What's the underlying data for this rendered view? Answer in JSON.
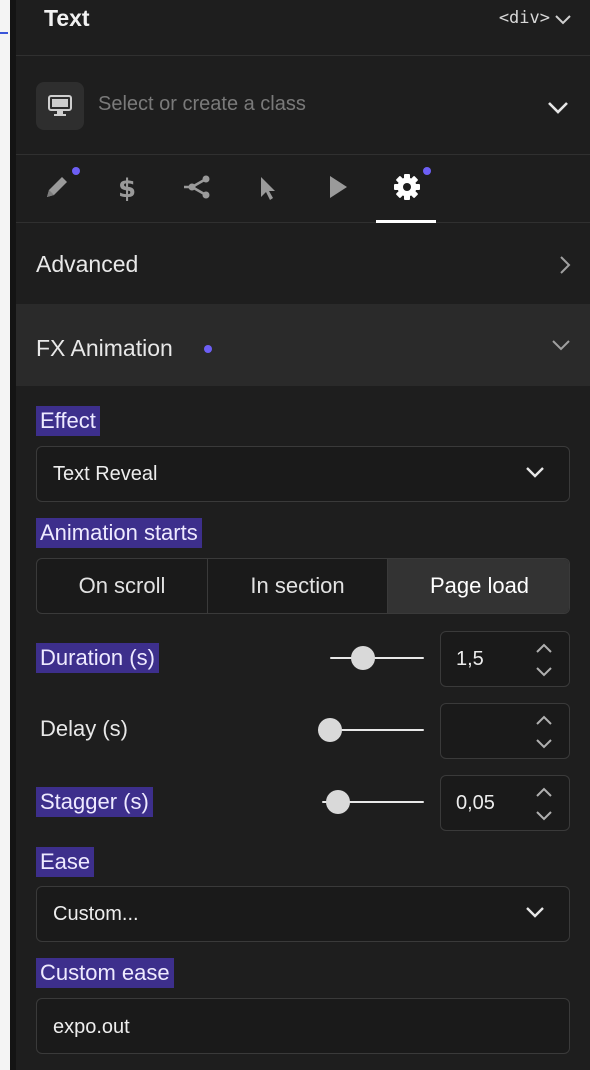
{
  "header": {
    "title": "Text",
    "tag": "<div>"
  },
  "class_selector": {
    "placeholder": "Select or create a class"
  },
  "tabs": [
    {
      "name": "style",
      "icon": "pencil-icon",
      "has_dot": true
    },
    {
      "name": "dollar",
      "icon": "dollar-icon",
      "has_dot": false
    },
    {
      "name": "share",
      "icon": "share-icon",
      "has_dot": false
    },
    {
      "name": "pointer",
      "icon": "cursor-icon",
      "has_dot": false
    },
    {
      "name": "play",
      "icon": "play-icon",
      "has_dot": false
    },
    {
      "name": "settings",
      "icon": "gear-icon",
      "has_dot": true,
      "active": true
    }
  ],
  "advanced": {
    "label": "Advanced"
  },
  "fx": {
    "label": "FX Animation"
  },
  "effect": {
    "label": "Effect",
    "value": "Text Reveal"
  },
  "animation_starts": {
    "label": "Animation starts",
    "options": [
      "On scroll",
      "In section",
      "Page load"
    ],
    "selected": "Page load"
  },
  "duration": {
    "label": "Duration (s)",
    "value": "1,5",
    "slider_fraction": 0.3
  },
  "delay": {
    "label": "Delay (s)",
    "value": "",
    "slider_fraction": 0
  },
  "stagger": {
    "label": "Stagger (s)",
    "value": "0,05",
    "slider_fraction": 0.05
  },
  "ease": {
    "label": "Ease",
    "value": "Custom..."
  },
  "custom_ease": {
    "label": "Custom ease",
    "value": "expo.out"
  },
  "colors": {
    "accent": "#6d5ff5",
    "highlight": "#3d2f8c",
    "panel": "#1e1e1e"
  }
}
